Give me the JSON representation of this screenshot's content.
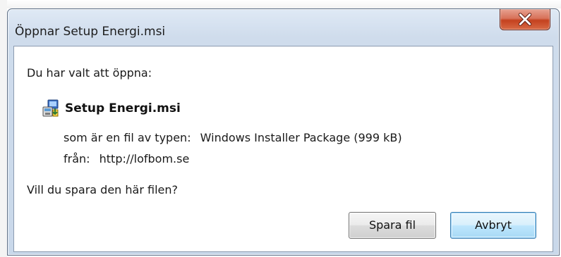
{
  "dialog": {
    "title": "Öppnar Setup Energi.msi",
    "close_label": "X",
    "prompt": "Du har valt att öppna:",
    "file": {
      "name": "Setup Energi.msi",
      "icon": "msi-installer-icon"
    },
    "type_label": "som är en fil av typen:",
    "type_value": "Windows Installer Package (999 kB)",
    "from_label": "från:",
    "from_value": "http://lofbom.se",
    "question": "Vill du spara den här filen?",
    "buttons": {
      "save": "Spara fil",
      "cancel": "Avbryt"
    }
  },
  "colors": {
    "frame": "#cfdcec",
    "close_button": "#c4411f",
    "default_button_border": "#3c7fb1"
  }
}
